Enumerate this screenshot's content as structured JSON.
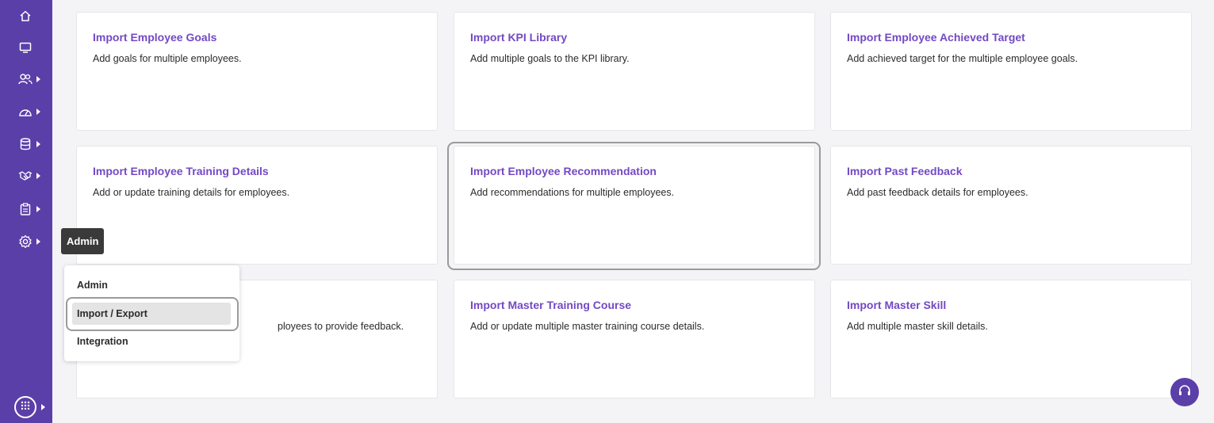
{
  "sidebar": {
    "items": [
      {
        "icon": "home-icon"
      },
      {
        "icon": "monitor-icon"
      },
      {
        "icon": "users-icon"
      },
      {
        "icon": "dashboard-gauge-icon"
      },
      {
        "icon": "database-icon"
      },
      {
        "icon": "handshake-icon"
      },
      {
        "icon": "clipboard-icon"
      },
      {
        "icon": "gear-icon"
      }
    ],
    "apps_icon": "apps-grid-icon"
  },
  "tooltip": {
    "label": "Admin"
  },
  "admin_menu": {
    "items": [
      {
        "label": "Admin"
      },
      {
        "label": "Import / Export"
      },
      {
        "label": "Integration"
      }
    ]
  },
  "cards": [
    {
      "title": "Import Employee Goals",
      "description": "Add goals for multiple employees."
    },
    {
      "title": "Import KPI Library",
      "description": "Add multiple goals to the KPI library."
    },
    {
      "title": "Import Employee Achieved Target",
      "description": "Add achieved target for the multiple employee goals."
    },
    {
      "title": "Import Employee Training Details",
      "description": "Add or update training details for employees."
    },
    {
      "title": "Import Employee Recommendation",
      "description": "Add recommendations for multiple employees."
    },
    {
      "title": "Import Past Feedback",
      "description": "Add past feedback details for employees."
    },
    {
      "title": "",
      "description": "ployees to provide feedback."
    },
    {
      "title": "Import Master Training Course",
      "description": "Add or update multiple master training course details."
    },
    {
      "title": "Import Master Skill",
      "description": "Add multiple master skill details."
    }
  ],
  "colors": {
    "sidebar_bg": "#5b3fa8",
    "accent": "#7349c4",
    "page_bg": "#f4f4f6"
  },
  "support_icon": "headset-icon"
}
